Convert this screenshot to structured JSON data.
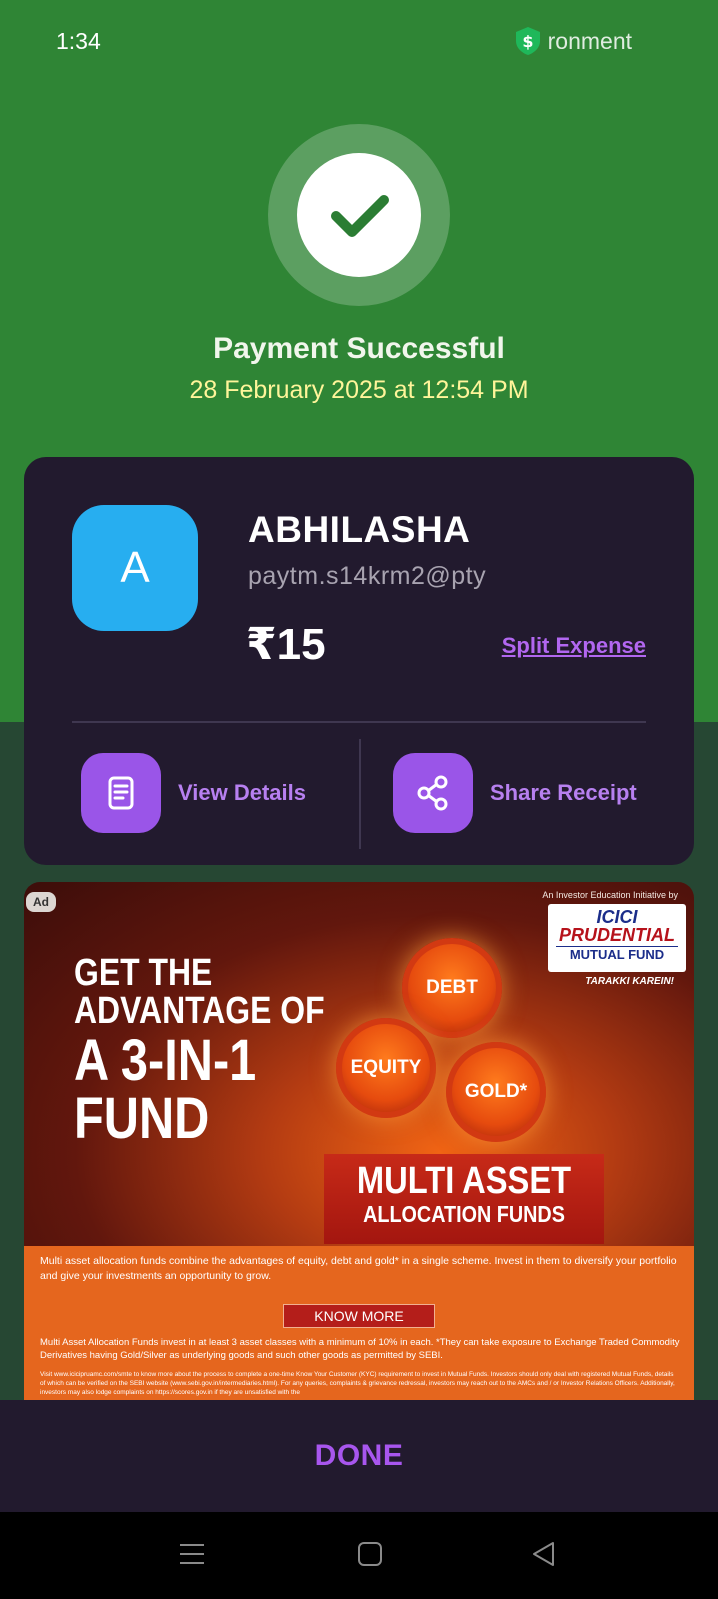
{
  "status_bar": {
    "time": "1:34",
    "app_label": "ronment"
  },
  "payment": {
    "title": "Payment Successful",
    "datetime": "28 February 2025 at 12:54 PM"
  },
  "payee": {
    "avatar_initial": "A",
    "name": "ABHILASHA",
    "upi_id": "paytm.s14krm2@pty",
    "amount": "₹15",
    "split_label": "Split Expense"
  },
  "actions": {
    "view_details": "View Details",
    "share_receipt": "Share Receipt"
  },
  "ad": {
    "badge": "Ad",
    "initiative": "An Investor Education Initiative by",
    "logo_line1": "ICICI",
    "logo_line2": "PRUDENTIAL",
    "logo_line3": "MUTUAL FUND",
    "tagline": "TARAKKI KAREIN!",
    "headline_1": "GET THE",
    "headline_2": "ADVANTAGE OF",
    "headline_3": "A 3-IN-1",
    "headline_4": "FUND",
    "orb_debt": "DEBT",
    "orb_equity": "EQUITY",
    "orb_gold": "GOLD*",
    "box_line1": "MULTI ASSET",
    "box_line2": "ALLOCATION FUNDS",
    "description": "Multi asset allocation funds combine the advantages of equity, debt and gold* in a single scheme. Invest in them to diversify your portfolio and give your investments an opportunity to grow.",
    "cta": "KNOW MORE",
    "fine_print_1": "Multi Asset Allocation Funds invest in at least 3 asset classes with a minimum of 10% in each. *They can take exposure to Exchange Traded Commodity Derivatives having Gold/Silver as underlying goods and such other goods as permitted by SEBI.",
    "fine_print_2": "Visit www.icicipruamc.com/smte to know more about the process to complete a one-time Know Your Customer (KYC) requirement to invest in Mutual Funds. Investors should only deal with registered Mutual Funds, details of which can be verified on the SEBI website (www.sebi.gov.in/intermediaries.html). For any queries, complaints & grievance redressal, investors may reach out to the AMCs and / or Investor Relations Officers. Additionally, investors may also lodge complaints on https://scores.gov.in if they are unsatisfied with the"
  },
  "footer": {
    "done_label": "DONE"
  },
  "colors": {
    "header_green": "#2f8535",
    "lower_green": "#264733",
    "card_bg": "#221a2e",
    "accent_purple": "#9a55e8",
    "avatar_blue": "#27aef0",
    "date_yellow": "#fff59a"
  },
  "icons": {
    "status": "shield-dollar-icon",
    "success": "checkmark-icon",
    "view_details": "receipt-document-icon",
    "share": "share-icon",
    "nav_recents": "recents-icon",
    "nav_home": "home-icon",
    "nav_back": "back-icon"
  }
}
